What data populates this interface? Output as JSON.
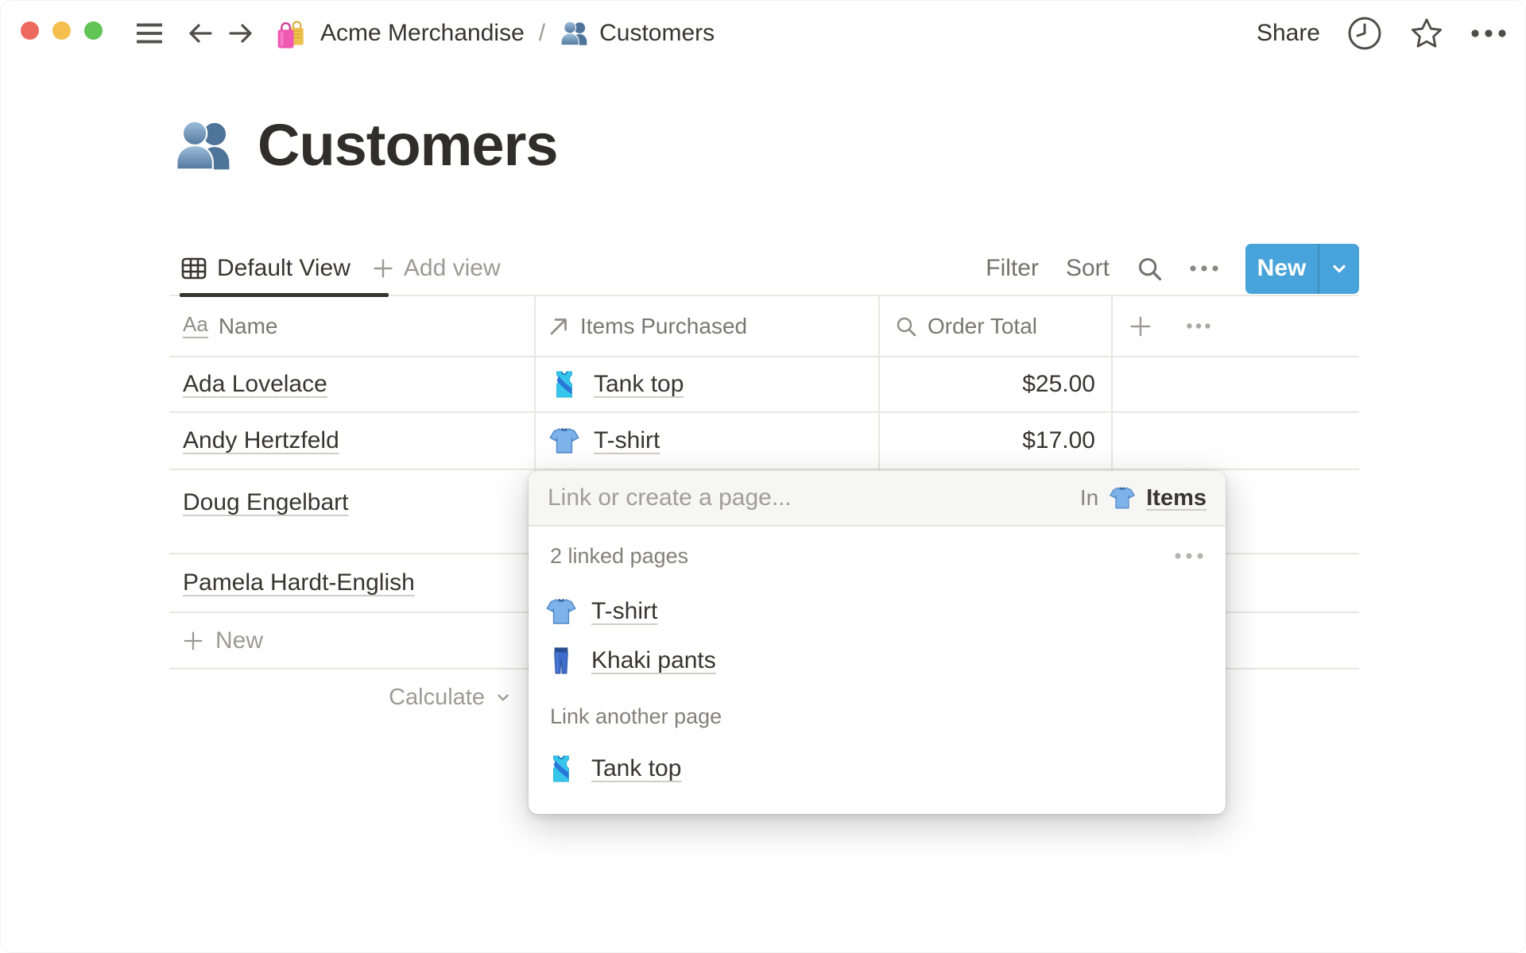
{
  "topbar": {
    "share_label": "Share",
    "breadcrumb": {
      "workspace": "Acme Merchandise",
      "separator": "/",
      "page": "Customers"
    }
  },
  "page": {
    "icon": "people-emoji",
    "title": "Customers"
  },
  "viewbar": {
    "active_view": "Default View",
    "add_view": "Add view",
    "filter": "Filter",
    "sort": "Sort",
    "new_button": "New"
  },
  "table": {
    "columns": [
      {
        "icon": "title-field-icon",
        "label": "Name"
      },
      {
        "icon": "relation-arrow-icon",
        "label": "Items Purchased"
      },
      {
        "icon": "rollup-magnifier-icon",
        "label": "Order Total"
      }
    ],
    "rows": [
      {
        "name": "Ada Lovelace",
        "item": "Tank top",
        "item_icon": "tank-top-emoji",
        "total": "$25.00"
      },
      {
        "name": "Andy Hertzfeld",
        "item": "T-shirt",
        "item_icon": "t-shirt-emoji",
        "total": "$17.00"
      },
      {
        "name": "Doug Engelbart",
        "item": "",
        "item_icon": "",
        "total": ""
      },
      {
        "name": "Pamela Hardt-English",
        "item": "",
        "item_icon": "",
        "total": ""
      }
    ],
    "footer": {
      "new_row": "New",
      "calculate": "Calculate"
    }
  },
  "popup": {
    "placeholder": "Link or create a page...",
    "in_label": "In",
    "in_page": {
      "icon": "t-shirt-emoji",
      "label": "Items"
    },
    "linked_header": "2 linked pages",
    "linked_pages": [
      {
        "icon": "t-shirt-emoji",
        "label": "T-shirt"
      },
      {
        "icon": "jeans-emoji",
        "label": "Khaki pants"
      }
    ],
    "link_another_label": "Link another page",
    "suggestions": [
      {
        "icon": "tank-top-emoji",
        "label": "Tank top"
      }
    ]
  },
  "colors": {
    "accent": "#47a3d9",
    "text": "#37352f",
    "muted_text": "#787774",
    "traffic_red": "#ed6a5e",
    "traffic_yellow": "#f5bf4f",
    "traffic_green": "#61c454"
  }
}
